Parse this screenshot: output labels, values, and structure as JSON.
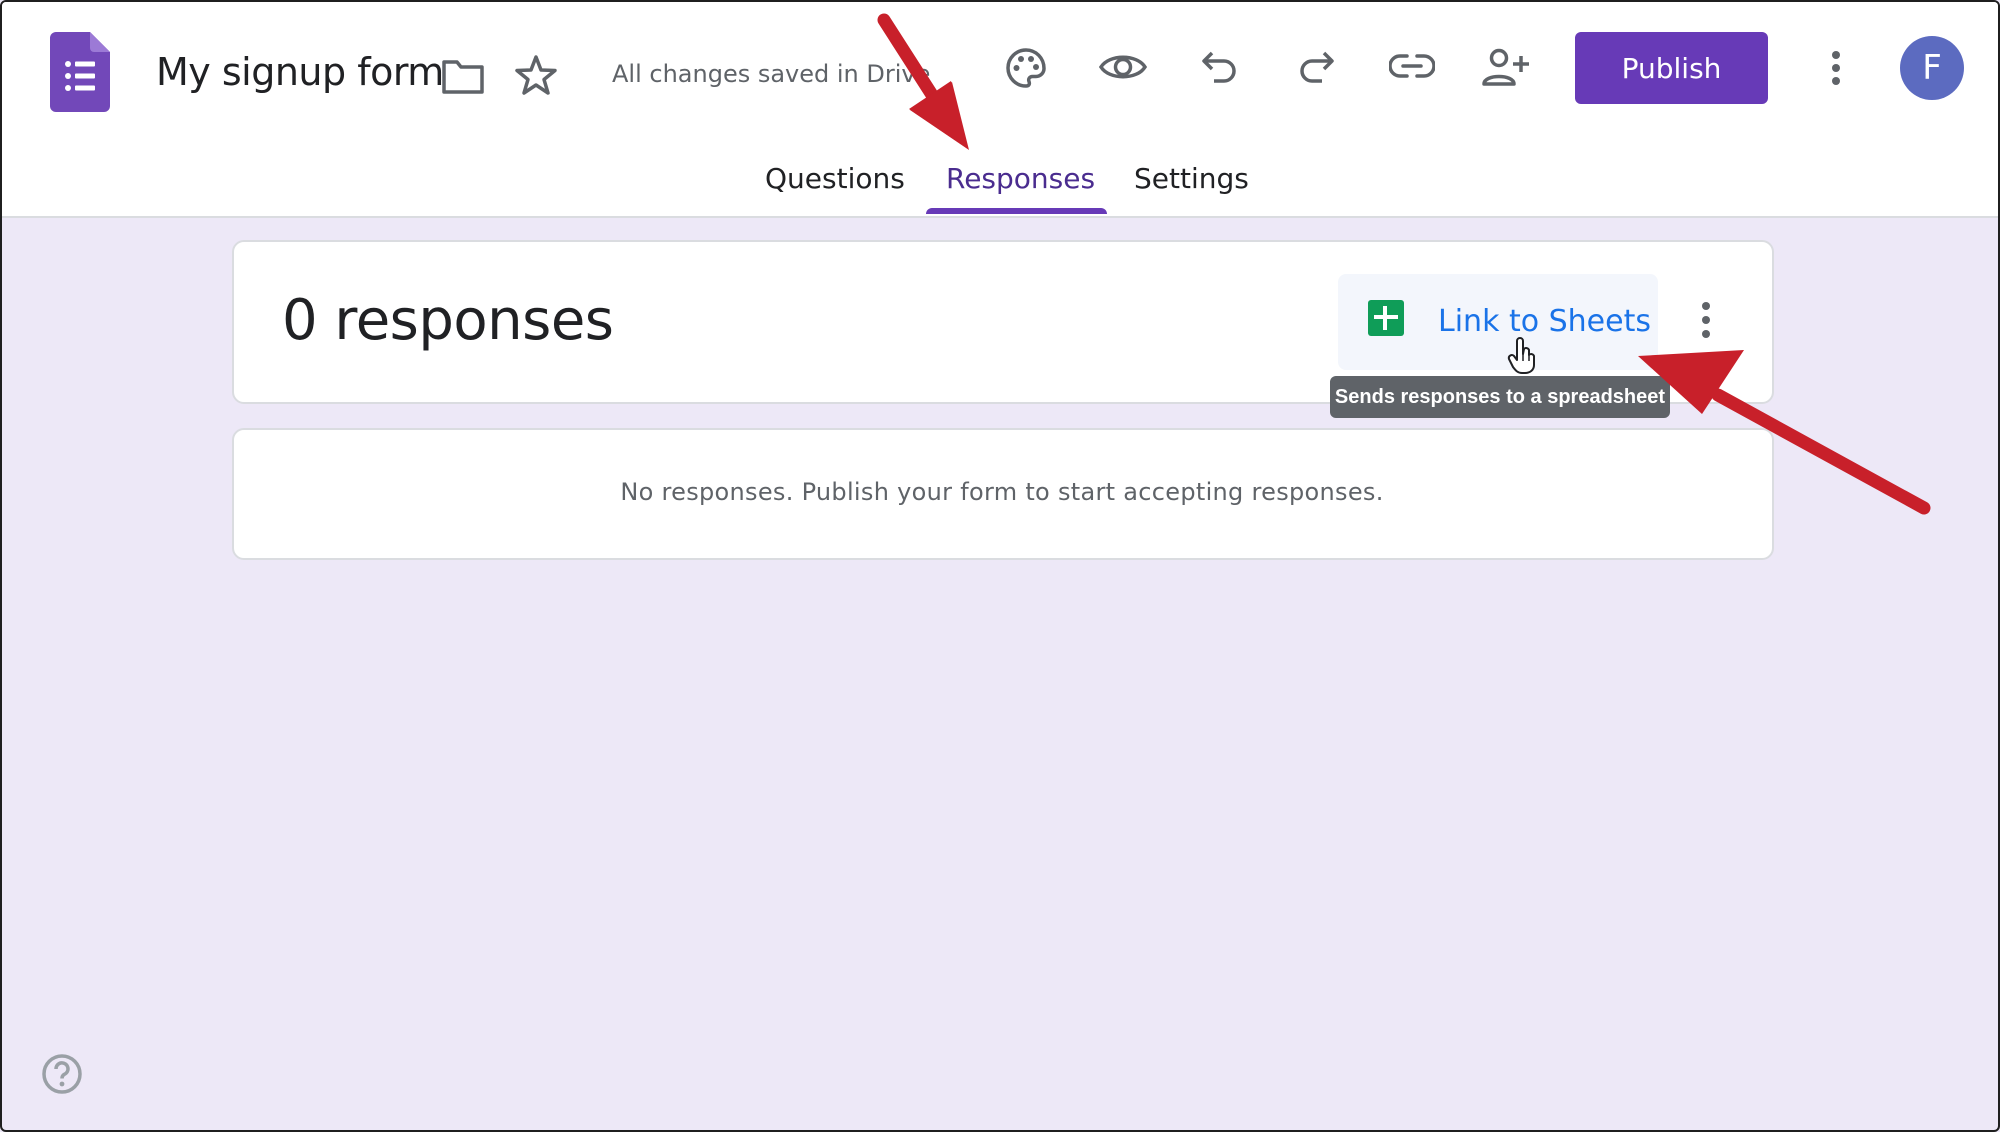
{
  "header": {
    "form_title": "My signup form",
    "save_status": "All changes saved in Drive",
    "publish_label": "Publish",
    "avatar_initial": "F",
    "icons": [
      "forms-logo-icon",
      "folder-icon",
      "star-icon",
      "palette-icon",
      "eye-icon",
      "undo-icon",
      "redo-icon",
      "link-icon",
      "add-person-icon",
      "more-vert-icon"
    ]
  },
  "tabs": [
    {
      "label": "Questions",
      "active": false
    },
    {
      "label": "Responses",
      "active": true
    },
    {
      "label": "Settings",
      "active": false
    }
  ],
  "responses": {
    "count_text": "0 responses",
    "link_sheets_label": "Link to Sheets",
    "tooltip": "Sends responses to a spreadsheet",
    "empty_message": "No responses. Publish your form to start accepting responses."
  },
  "colors": {
    "accent": "#673ab7",
    "link": "#1a73e8",
    "sheets_green": "#0f9d58",
    "background": "#ede8f7",
    "annotation_arrow": "#c8202a"
  }
}
